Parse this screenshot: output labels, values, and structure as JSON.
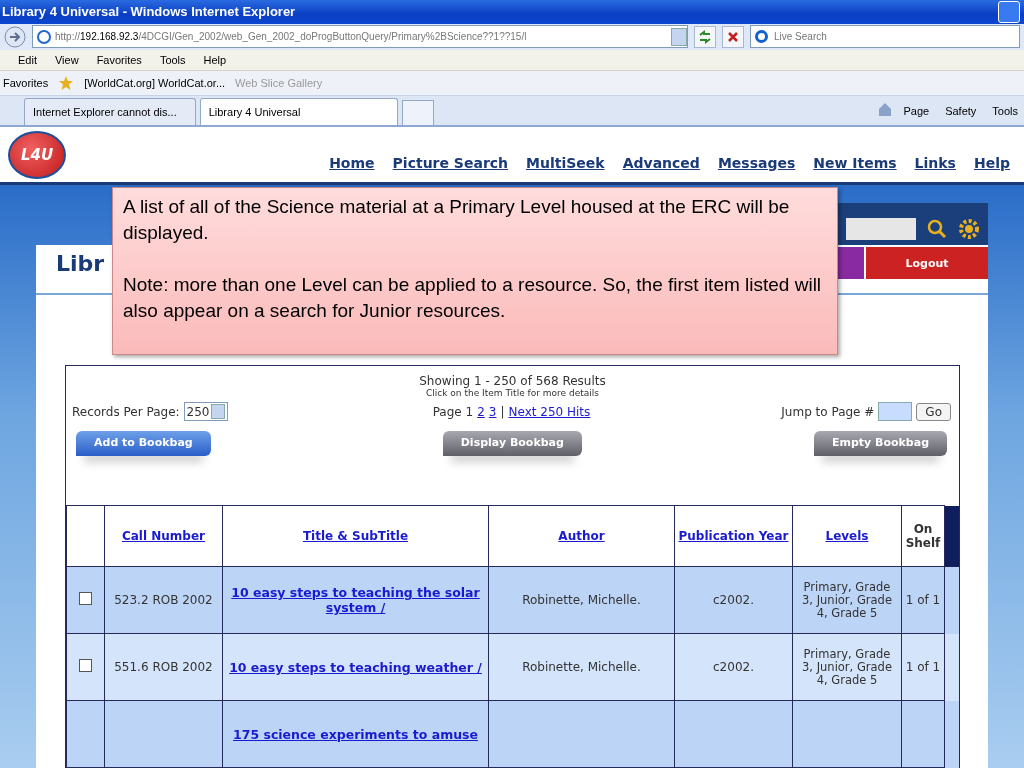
{
  "window": {
    "title": "Library 4 Universal - Windows Internet Explorer"
  },
  "address_bar": {
    "url_prefix": "http://",
    "url_host": "192.168.92.3",
    "url_path": "/4DCGI/Gen_2002/web_Gen_2002_doProgButtonQuery/Primary%2BScience??1??15/l",
    "search_placeholder": "Live Search"
  },
  "menu": [
    "Edit",
    "View",
    "Favorites",
    "Tools",
    "Help"
  ],
  "favorites_bar": {
    "label": "Favorites",
    "links": [
      {
        "label": "[WorldCat.org] WorldCat.or...",
        "disabled": false
      },
      {
        "label": "Web Slice Gallery",
        "disabled": true
      }
    ]
  },
  "tabs": [
    {
      "label": "Internet Explorer cannot dis...",
      "selected": false
    },
    {
      "label": "Library 4 Universal",
      "selected": true
    }
  ],
  "command_bar": [
    "Page",
    "Safety",
    "Tools"
  ],
  "site": {
    "logo": "L4U",
    "nav": [
      "Home",
      "Picture Search",
      "MultiSeek",
      "Advanced",
      "Messages",
      "New Items",
      "Links",
      "Help"
    ],
    "page_title": "Libr",
    "logout": "Logout"
  },
  "callout": {
    "paragraphs": [
      "A list of all of the Science material at a Primary Level  housed at the ERC will be displayed.",
      "Note:  more than one Level can be applied to a resource.  So, the first item listed will also appear on a search for Junior resources."
    ]
  },
  "results": {
    "showing": "Showing 1 - 250 of 568 Results",
    "hint": "Click on the Item Title for more details",
    "records_label": "Records Per Page:",
    "records_value": "250",
    "page_label": "Page 1",
    "pages": [
      "2",
      "3"
    ],
    "separator": "|",
    "next": "Next 250 Hits",
    "jump_label": "Jump to Page #",
    "go": "Go",
    "buttons": [
      {
        "label": "Add to Bookbag",
        "kind": "primary"
      },
      {
        "label": "Display Bookbag",
        "kind": "secondary"
      },
      {
        "label": "Empty Bookbag",
        "kind": "secondary"
      }
    ]
  },
  "table": {
    "columns": [
      "Call Number",
      "Title & SubTitle",
      "Author",
      "Publication Year",
      "Levels",
      "On Shelf"
    ],
    "rows": [
      {
        "checked": false,
        "call_number": "523.2 ROB 2002",
        "title": "10 easy steps to teaching the solar system /",
        "author": "Robinette, Michelle.",
        "year": "c2002.",
        "levels": "Primary, Grade 3, Junior, Grade 4, Grade 5",
        "on_shelf": "1 of 1"
      },
      {
        "checked": false,
        "call_number": "551.6 ROB 2002",
        "title": "10 easy steps to teaching weather /",
        "author": "Robinette, Michelle.",
        "year": "c2002.",
        "levels": "Primary, Grade 3, Junior, Grade 4, Grade 5",
        "on_shelf": "1 of 1"
      },
      {
        "title": "175 science experiments to amuse"
      }
    ]
  }
}
